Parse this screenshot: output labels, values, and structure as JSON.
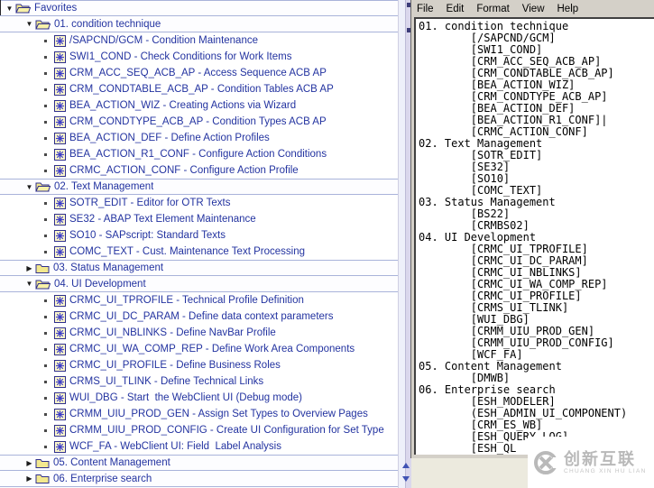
{
  "tree": {
    "name": "SAP Favorites tree",
    "rows": [
      {
        "type": "folder",
        "level": 0,
        "state": "open",
        "label": "Favorites"
      },
      {
        "type": "folder",
        "level": 1,
        "state": "open",
        "label": "01. condition technique"
      },
      {
        "type": "item",
        "label": "/SAPCND/GCM - Condition Maintenance"
      },
      {
        "type": "item",
        "label": "SWI1_COND - Check Conditions for Work Items"
      },
      {
        "type": "item",
        "label": "CRM_ACC_SEQ_ACB_AP - Access Sequence ACB AP"
      },
      {
        "type": "item",
        "label": "CRM_CONDTABLE_ACB_AP - Condition Tables ACB AP"
      },
      {
        "type": "item",
        "label": "BEA_ACTION_WIZ - Creating Actions via Wizard"
      },
      {
        "type": "item",
        "label": "CRM_CONDTYPE_ACB_AP - Condition Types ACB AP"
      },
      {
        "type": "item",
        "label": "BEA_ACTION_DEF - Define Action Profiles"
      },
      {
        "type": "item",
        "label": "BEA_ACTION_R1_CONF - Configure Action Conditions"
      },
      {
        "type": "item",
        "label": "CRMC_ACTION_CONF - Configure Action Profile"
      },
      {
        "type": "folder",
        "level": 1,
        "state": "open",
        "label": "02. Text Management"
      },
      {
        "type": "item",
        "label": "SOTR_EDIT - Editor for OTR Texts"
      },
      {
        "type": "item",
        "label": "SE32 - ABAP Text Element Maintenance"
      },
      {
        "type": "item",
        "label": "SO10 - SAPscript: Standard Texts"
      },
      {
        "type": "item",
        "label": "COMC_TEXT - Cust. Maintenance Text Processing"
      },
      {
        "type": "folder",
        "level": 1,
        "state": "closed",
        "label": "03. Status Management"
      },
      {
        "type": "folder",
        "level": 1,
        "state": "open",
        "label": "04. UI Development"
      },
      {
        "type": "item",
        "label": "CRMC_UI_TPROFILE - Technical Profile Definition"
      },
      {
        "type": "item",
        "label": "CRMC_UI_DC_PARAM - Define data context parameters"
      },
      {
        "type": "item",
        "label": "CRMC_UI_NBLINKS - Define NavBar Profile"
      },
      {
        "type": "item",
        "label": "CRMC_UI_WA_COMP_REP - Define Work Area Components"
      },
      {
        "type": "item",
        "label": "CRMC_UI_PROFILE - Define Business Roles"
      },
      {
        "type": "item",
        "label": "CRMS_UI_TLINK - Define Technical Links"
      },
      {
        "type": "item",
        "label": "WUI_DBG - Start  the WebClient UI (Debug mode)"
      },
      {
        "type": "item",
        "label": "CRMM_UIU_PROD_GEN - Assign Set Types to Overview Pages"
      },
      {
        "type": "item",
        "label": "CRMM_UIU_PROD_CONFIG - Create UI Configuration for Set Type"
      },
      {
        "type": "item",
        "label": "WCF_FA - WebClient UI: Field  Label Analysis"
      },
      {
        "type": "folder",
        "level": 1,
        "state": "closed",
        "label": "05. Content Management"
      },
      {
        "type": "folder",
        "level": 1,
        "state": "closed",
        "label": "06. Enterprise search"
      }
    ]
  },
  "notepad": {
    "menu": [
      "File",
      "Edit",
      "Format",
      "View",
      "Help"
    ],
    "lines": [
      "01. condition technique",
      "        [/SAPCND/GCM]",
      "        [SWI1_COND]",
      "        [CRM_ACC_SEQ_ACB_AP]",
      "        [CRM_CONDTABLE_ACB_AP]",
      "        [BEA_ACTION_WIZ]",
      "        [CRM_CONDTYPE_ACB_AP]",
      "        [BEA_ACTION_DEF]",
      "        [BEA_ACTION_R1_CONF]|",
      "        [CRMC_ACTION_CONF]",
      "02. Text Management",
      "        [SOTR_EDIT]",
      "        [SE32]",
      "        [SO10]",
      "        [COMC_TEXT]",
      "03. Status Management",
      "        [BS22]",
      "        [CRMBS02]",
      "04. UI Development",
      "        [CRMC_UI_TPROFILE]",
      "        [CRMC_UI_DC_PARAM]",
      "        [CRMC_UI_NBLINKS]",
      "        [CRMC_UI_WA_COMP_REP]",
      "        [CRMC_UI_PROFILE]",
      "        [CRMS_UI_TLINK]",
      "        [WUI_DBG]",
      "        [CRMM_UIU_PROD_GEN]",
      "        [CRMM_UIU_PROD_CONFIG]",
      "        [WCF_FA]",
      "05. Content Management",
      "        [DMWB]",
      "06. Enterprise search",
      "        [ESH_MODELER]",
      "        (ESH_ADMIN_UI_COMPONENT)",
      "        [CRM_ES_WB]",
      "        [ESH_QUERY_LOG]",
      "        [ESH_QL"
    ]
  },
  "watermark": {
    "title": "创新互联",
    "subtitle": "CHUANG XIN HU LIAN"
  },
  "colors": {
    "tree_text": "#2333a0",
    "folder_fill": "#f3e88e",
    "icon_outline": "#2f2f8c",
    "asterisk_blue": "#4040c8",
    "row_separator": "#a9b3da",
    "menu_bg": "#d4d0c8",
    "editor_bg": "#ffffff",
    "scrollbar_arrow": "#4053b4",
    "watermark_gray": "#b9b9b9"
  }
}
